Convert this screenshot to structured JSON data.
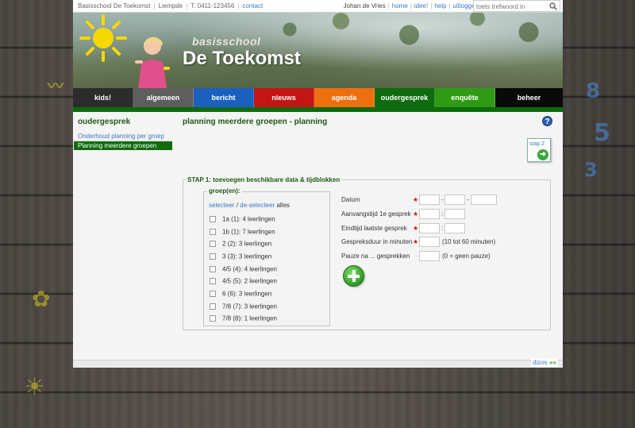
{
  "topbar": {
    "school": "Basisschool De Toekomst",
    "city": "Liempde",
    "phone": "T. 0411-123456",
    "contact": "contact",
    "user": "Johan de Vries",
    "links": [
      "home",
      "idee!",
      "help",
      "uitloggen"
    ],
    "search_placeholder": "toets trefwoord in"
  },
  "header": {
    "brand_small": "basisschool",
    "brand_big": "De Toekomst"
  },
  "nav": [
    {
      "label": "kids!",
      "color": "#2c2c2c"
    },
    {
      "label": "algemeen",
      "color": "#5e5e5e"
    },
    {
      "label": "bericht",
      "color": "#1b5fbf"
    },
    {
      "label": "nieuws",
      "color": "#c41414"
    },
    {
      "label": "agenda",
      "color": "#ef6e0e"
    },
    {
      "label": "oudergesprek",
      "color": "#0e6b0e"
    },
    {
      "label": "enquête",
      "color": "#2f9b14"
    },
    {
      "label": "beheer",
      "color": "#0a0a0a"
    }
  ],
  "sidebar": {
    "title": "oudergesprek",
    "items": [
      "Onderhoud planning per groep",
      "Planning meerdere groepen"
    ]
  },
  "main": {
    "title": "planning meerdere groepen - planning",
    "step_button": "stap 2",
    "step_title": "STAP 1: toevoegen beschikbare data & tijdblokken",
    "group_legend": "groep(en):",
    "select": "selecteer",
    "select_sep": "/",
    "deselect": "de-selecteer",
    "select_suffix": "alles",
    "groups": [
      "1a (1): 4 leerlingen",
      "1b (1): 7 leerlingen",
      "2 (2): 3 leerlingen",
      "3 (3): 3 leerlingen",
      "4/5 (4): 4 leerlingen",
      "4/5 (5): 2 leerlingen",
      "6 (6): 3 leerlingen",
      "7/8 (7): 3 leerlingen",
      "7/8 (8): 1 leerlingen"
    ],
    "fields": {
      "datum": "Datum",
      "aanvang": "Aanvangstijd 1e gesprek",
      "eind": "Eindtijd laatste gesprek",
      "duur": "Gespreksduur in minuten",
      "pauze": "Pauze na ... gesprekken"
    },
    "duur_hint": "(10 tot 60 minuten)",
    "pauze_hint": "(0 = geen pauze)",
    "required_mark": "★",
    "date_sep": "-",
    "time_sep": ":"
  },
  "footer": {
    "brand": "dizos"
  }
}
